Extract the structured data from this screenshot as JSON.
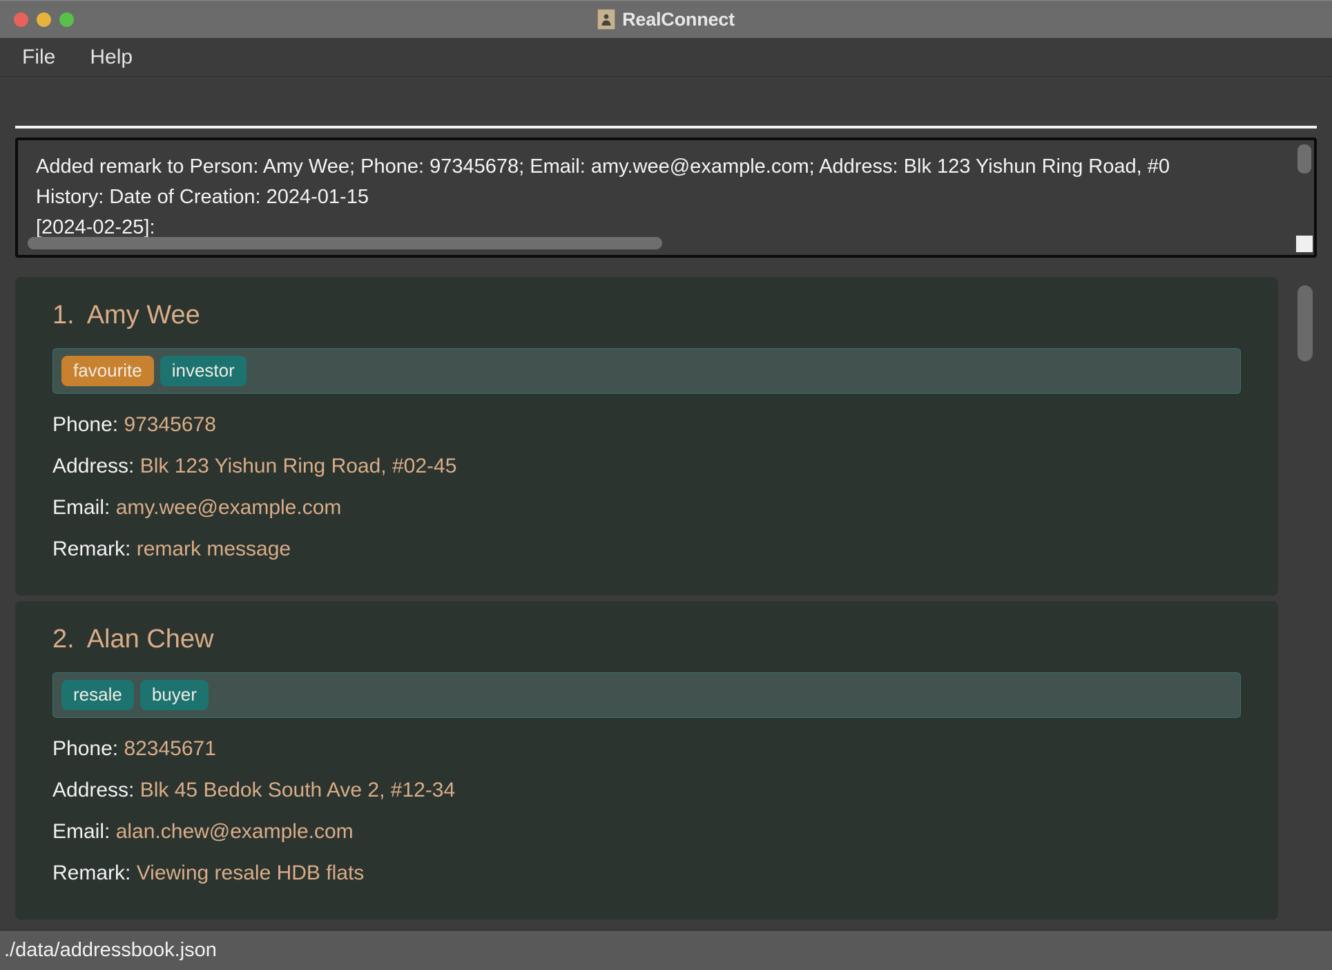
{
  "window": {
    "title": "RealConnect",
    "title_icon": "contact-person-icon",
    "traffic_lights": {
      "close": "close-window-button",
      "minimize": "minimize-window-button",
      "zoom": "zoom-window-button"
    }
  },
  "menubar": {
    "items": [
      {
        "label": "File"
      },
      {
        "label": "Help"
      }
    ]
  },
  "command": {
    "value": "",
    "placeholder": ""
  },
  "result": {
    "lines": [
      "Added remark to Person: Amy Wee; Phone: 97345678; Email: amy.wee@example.com; Address: Blk 123 Yishun Ring Road, #0",
      "History: Date of Creation: 2024-01-15",
      "[2024-02-25]:"
    ]
  },
  "persons": [
    {
      "index": "1.",
      "name": "Amy Wee",
      "tags": [
        {
          "label": "favourite",
          "style": "orange"
        },
        {
          "label": "investor",
          "style": "teal"
        }
      ],
      "fields": [
        {
          "label": "Phone:",
          "value": "97345678"
        },
        {
          "label": "Address:",
          "value": "Blk 123 Yishun Ring Road, #02-45"
        },
        {
          "label": "Email:",
          "value": "amy.wee@example.com"
        },
        {
          "label": "Remark:",
          "value": "remark message"
        }
      ]
    },
    {
      "index": "2.",
      "name": "Alan Chew",
      "tags": [
        {
          "label": "resale",
          "style": "teal"
        },
        {
          "label": "buyer",
          "style": "teal"
        }
      ],
      "fields": [
        {
          "label": "Phone:",
          "value": "82345671"
        },
        {
          "label": "Address:",
          "value": "Blk 45 Bedok South Ave 2, #12-34"
        },
        {
          "label": "Email:",
          "value": "alan.chew@example.com"
        },
        {
          "label": "Remark:",
          "value": "Viewing resale HDB flats"
        }
      ]
    }
  ],
  "statusbar": {
    "save_location": "./data/addressbook.json"
  },
  "colors": {
    "accent_name": "#d9ad87",
    "tag_orange": "#c8812f",
    "tag_teal": "#1c7370",
    "card_bg": "#2c3430",
    "tag_bar_bg": "#42534f",
    "window_bg": "#3c3c3c",
    "titlebar_bg": "#6b6b6b",
    "statusbar_bg": "#595959"
  }
}
